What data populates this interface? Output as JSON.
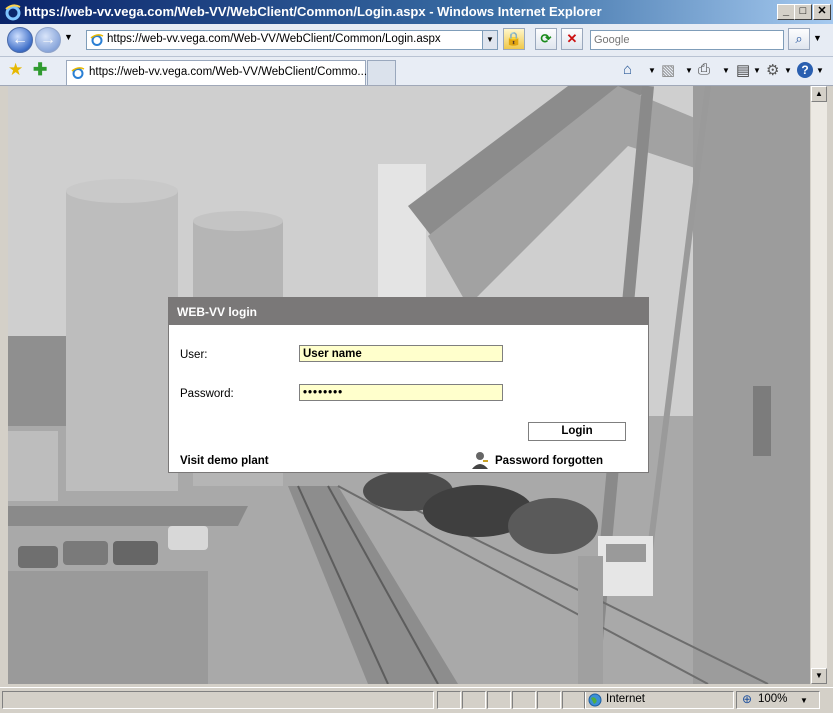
{
  "window": {
    "title": "https://web-vv.vega.com/Web-VV/WebClient/Common/Login.aspx - Windows Internet Explorer"
  },
  "address_bar": {
    "url": "https://web-vv.vega.com/Web-VV/WebClient/Common/Login.aspx",
    "search_placeholder": "Google"
  },
  "tab": {
    "label": "https://web-vv.vega.com/Web-VV/WebClient/Commo..."
  },
  "login": {
    "title": "WEB-VV login",
    "user_label": "User:",
    "user_value": "User name",
    "password_label": "Password:",
    "password_value": "••••••••",
    "login_button": "Login",
    "demo_link": "Visit demo plant",
    "forgot_link": "Password forgotten"
  },
  "status": {
    "zone": "Internet",
    "zoom": "100%"
  },
  "colors": {
    "dialog_header": "#7a7878",
    "input_bg": "#ffffcc"
  },
  "icons": [
    "ie-icon",
    "back-icon",
    "forward-icon",
    "lock-icon",
    "refresh-icon",
    "stop-icon",
    "search-icon",
    "favorites-star-icon",
    "add-favorites-icon",
    "home-icon",
    "feeds-icon",
    "print-icon",
    "page-icon",
    "tools-gear-icon",
    "help-icon",
    "globe-icon",
    "user-key-icon"
  ]
}
